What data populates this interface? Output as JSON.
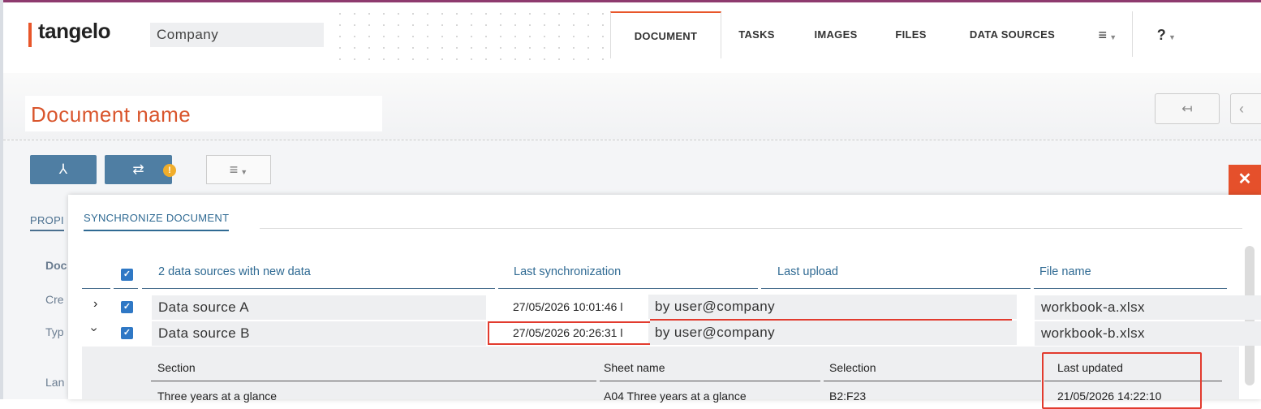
{
  "app": {
    "logo": "tangelo",
    "company": "Company",
    "tabs": [
      "DOCUMENT",
      "TASKS",
      "IMAGES",
      "FILES",
      "DATA SOURCES"
    ],
    "menu_glyph": "≡",
    "help_glyph": "?"
  },
  "header": {
    "document_name": "Document name",
    "back_glyph": "↤",
    "prev_glyph": "‹"
  },
  "toolbar": {
    "pdf_glyph": "⅄",
    "sync_glyph": "⇄",
    "warning_glyph": "!",
    "menu_glyph": "≡",
    "close_glyph": "✕"
  },
  "properties": {
    "tab_label": "PROPI",
    "labels": [
      "Doc",
      "Cre",
      "Typ",
      "Lan"
    ]
  },
  "modal": {
    "tab_label": "SYNCHRONIZE DOCUMENT",
    "columns": {
      "sources": "2 data sources with new data",
      "last_sync": "Last synchronization",
      "last_upload": "Last upload",
      "file_name": "File name"
    },
    "rows": [
      {
        "name": "Data source A",
        "last_sync": "27/05/2026 10:01:46 by user@company",
        "sync_short": "27/05/2026 10:01:46 l",
        "upload": "by user@company",
        "file": "workbook-a.xlsx",
        "expanded": false
      },
      {
        "name": "Data source B",
        "last_sync": "27/05/2026 20:26:31 by user@company",
        "sync_short": "27/05/2026 20:26:31 l",
        "upload": "by user@company",
        "file": "workbook-b.xlsx",
        "expanded": true
      }
    ],
    "subtable": {
      "columns": {
        "section": "Section",
        "sheet": "Sheet name",
        "selection": "Selection",
        "updated": "Last updated"
      },
      "rows": [
        {
          "section": "Three years at a glance",
          "sheet": "A04 Three years at a glance",
          "selection": "B2:F23",
          "updated": "21/05/2026 14:22:10"
        }
      ]
    }
  },
  "colors": {
    "accent": "#e8562a",
    "primary": "#2f6a93",
    "button": "#4f7ea3",
    "highlight": "#e23b2e"
  }
}
